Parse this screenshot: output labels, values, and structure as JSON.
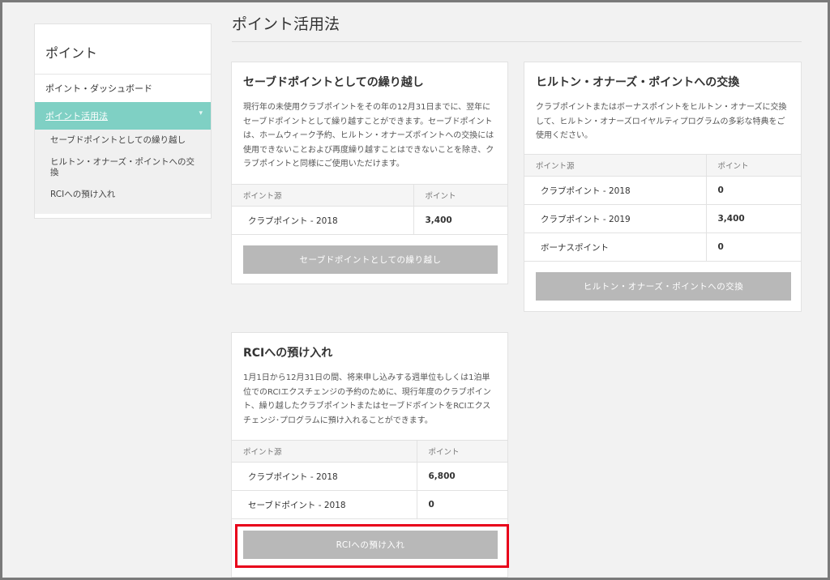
{
  "page": {
    "title": "ポイント活用法"
  },
  "sidebar": {
    "title": "ポイント",
    "items": [
      {
        "label": "ポイント・ダッシュボード"
      },
      {
        "label": "ポイント活用法"
      }
    ],
    "sub_items": [
      {
        "label": "セーブドポイントとしての繰り越し"
      },
      {
        "label": "ヒルトン・オナーズ・ポイントへの交換"
      },
      {
        "label": "RCIへの預け入れ"
      }
    ]
  },
  "cards": {
    "saved": {
      "title": "セーブドポイントとしての繰り越し",
      "description": "現行年の未使用クラブポイントをその年の12月31日までに、翌年にセーブドポイントとして繰り越すことができます。セーブドポイントは、ホームウィーク予約、ヒルトン・オナーズポイントへの交換には使用できないことおよび再度繰り越すことはできないことを除き、クラブポイントと同様にご使用いただけます。",
      "col_source": "ポイント源",
      "col_points": "ポイント",
      "rows": [
        {
          "source": "クラブポイント - 2018",
          "points": "3,400"
        }
      ],
      "button": "セーブドポイントとしての繰り越し"
    },
    "hilton": {
      "title": "ヒルトン・オナーズ・ポイントへの交換",
      "description": "クラブポイントまたはボーナスポイントをヒルトン・オナーズに交換して、ヒルトン・オナーズロイヤルティプログラムの多彩な特典をご使用ください。",
      "col_source": "ポイント源",
      "col_points": "ポイント",
      "rows": [
        {
          "source": "クラブポイント - 2018",
          "points": "0"
        },
        {
          "source": "クラブポイント - 2019",
          "points": "3,400"
        },
        {
          "source": "ボーナスポイント",
          "points": "0"
        }
      ],
      "button": "ヒルトン・オナーズ・ポイントへの交換"
    },
    "rci": {
      "title": "RCIへの預け入れ",
      "description": "1月1日から12月31日の間、将来申し込みする週単位もしくは1泊単位でのRCIエクスチェンジの予約のために、現行年度のクラブポイント、繰り越したクラブポイントまたはセーブドポイントをRCIエクスチェンジ･プログラムに預け入れることができます。",
      "col_source": "ポイント源",
      "col_points": "ポイント",
      "rows": [
        {
          "source": "クラブポイント - 2018",
          "points": "6,800"
        },
        {
          "source": "セーブドポイント - 2018",
          "points": "0"
        }
      ],
      "button": "RCIへの預け入れ"
    }
  },
  "colors": {
    "accent": "#7fd0c4",
    "button": "#b8b8b8",
    "highlight": "#e8001a"
  },
  "icons": {
    "active_chevron": "chevron-down-icon"
  }
}
